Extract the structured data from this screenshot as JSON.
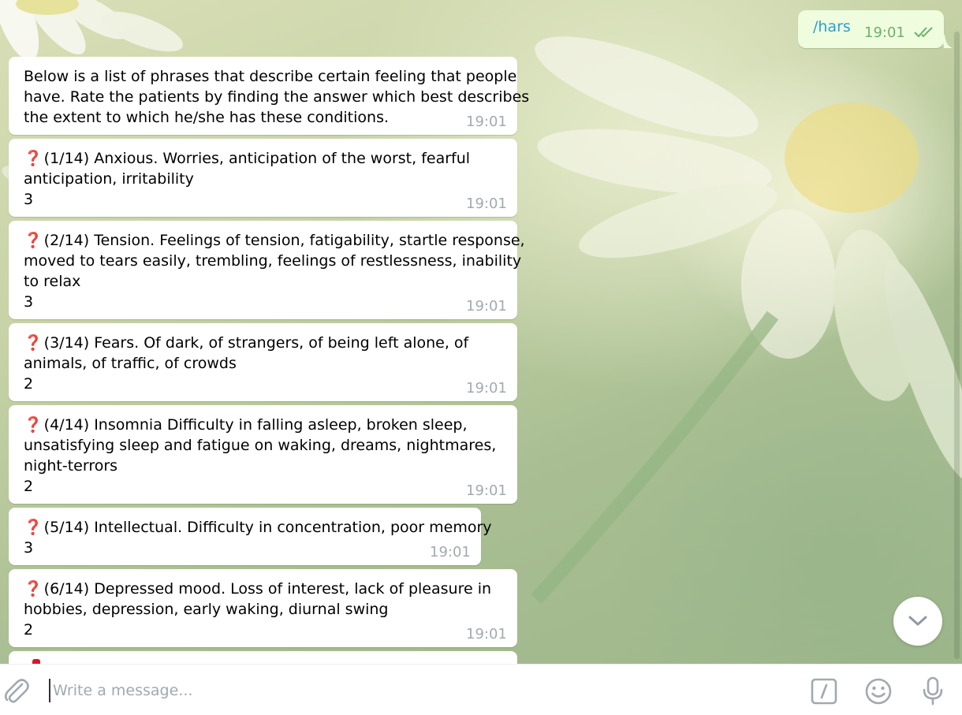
{
  "composer": {
    "placeholder": "Write a message..."
  },
  "outgoing": {
    "text": "/hars",
    "time": "19:01"
  },
  "messages": [
    {
      "lines": [
        "Below is a list of phrases that describe certain feeling that people",
        "have. Rate the patients by finding the answer which best describes",
        "the extent to which he/she has these conditions."
      ],
      "time": "19:01"
    },
    {
      "lines": [
        "(1/14) Anxious. Worries, anticipation of the worst, fearful",
        "anticipation, irritability"
      ],
      "answer": "3",
      "time": "19:01"
    },
    {
      "lines": [
        "(2/14) Tension. Feelings of tension, fatigability, startle response,",
        "moved to tears easily, trembling, feelings of restlessness, inability",
        "to relax"
      ],
      "answer": "3",
      "time": "19:01"
    },
    {
      "lines": [
        "(3/14) Fears. Of dark, of strangers, of being left alone, of",
        "animals, of traffic, of crowds"
      ],
      "answer": "2",
      "time": "19:01"
    },
    {
      "lines": [
        "(4/14) Insomnia Difficulty in falling asleep, broken sleep,",
        "unsatisfying sleep and fatigue on waking, dreams, nightmares,",
        "night-terrors"
      ],
      "answer": "2",
      "time": "19:01"
    },
    {
      "lines": [
        "(5/14) Intellectual. Difficulty in concentration, poor memory"
      ],
      "answer": "3",
      "time": "19:01"
    },
    {
      "lines": [
        "(6/14) Depressed mood. Loss of interest, lack of pleasure in",
        "hobbies, depression, early waking, diurnal swing"
      ],
      "answer": "2",
      "time": "19:01"
    }
  ],
  "icons": {
    "question": "❓",
    "attach": "paperclip-icon",
    "bot_command": "slash-command-icon",
    "emoji": "smile-icon",
    "mic": "microphone-icon",
    "scroll_down": "chevron-down-icon",
    "read_status": "double-check-icon"
  },
  "colors": {
    "outgoing_bubble": "#effdde",
    "outgoing_meta": "#6cb36a",
    "link": "#2a9fd6",
    "incoming_time": "#a1aab1",
    "question_mark": "#d8162d"
  }
}
